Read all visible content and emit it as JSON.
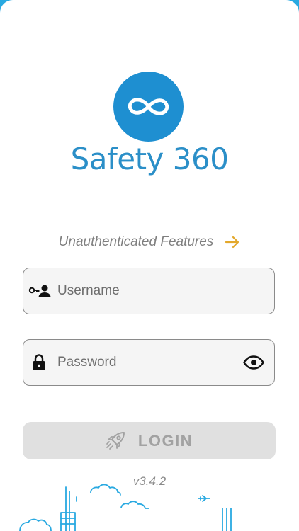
{
  "app": {
    "brand_name": "Safety 360",
    "logo_icon": "infinity-icon",
    "brand_color": "#2b8fc8",
    "logo_color": "#1e8fd1"
  },
  "unauthenticated": {
    "label": "Unauthenticated Features",
    "icon": "arrow-right-icon",
    "icon_color": "#e3a82b"
  },
  "form": {
    "username": {
      "placeholder": "Username",
      "value": "",
      "icon": "user-key-icon"
    },
    "password": {
      "placeholder": "Password",
      "value": "",
      "icon": "lock-icon",
      "toggle_icon": "eye-icon"
    },
    "login": {
      "label": "LOGIN",
      "icon": "rocket-icon",
      "enabled": false
    }
  },
  "footer": {
    "version": "v3.4.2",
    "decoration": "city-skyline-outline",
    "decoration_color": "#29a9e1"
  }
}
